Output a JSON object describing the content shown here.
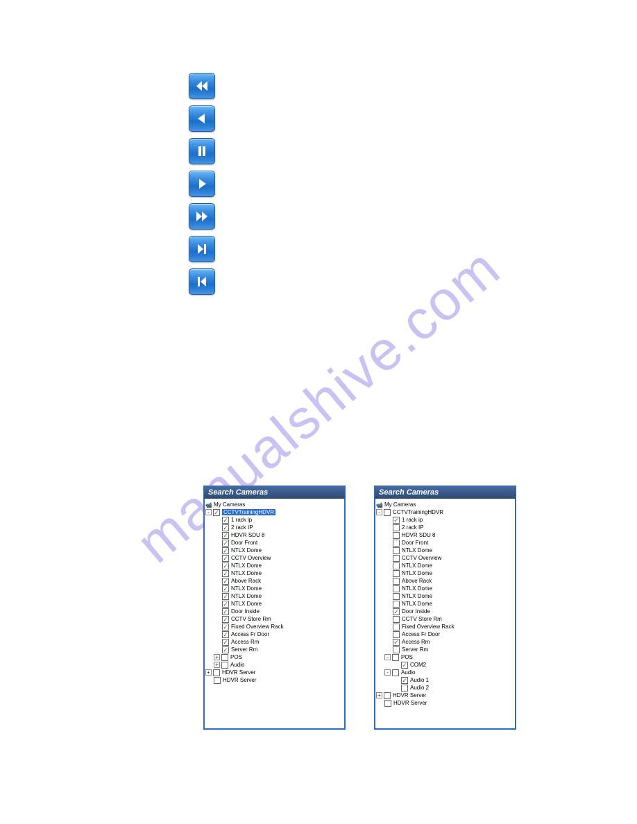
{
  "watermark": "manualshive.com",
  "buttons": [
    {
      "name": "rewind-button"
    },
    {
      "name": "step-back-button"
    },
    {
      "name": "pause-button"
    },
    {
      "name": "play-button"
    },
    {
      "name": "fast-forward-button"
    },
    {
      "name": "skip-forward-button"
    },
    {
      "name": "skip-back-button"
    }
  ],
  "panels": {
    "title": "Search Cameras",
    "left": {
      "root_label": "My Cameras",
      "server1": {
        "label": "CCTVTrainingHDVR",
        "selected": true,
        "checked": true,
        "expanded": true,
        "items": [
          {
            "label": "1 rack ip",
            "checked": true
          },
          {
            "label": "2 rack IP",
            "checked": true
          },
          {
            "label": "HDVR SDU 8",
            "checked": true
          },
          {
            "label": "Door Front",
            "checked": true
          },
          {
            "label": "NTLX Dome",
            "checked": true
          },
          {
            "label": "CCTV Overview",
            "checked": true
          },
          {
            "label": "NTLX Dome",
            "checked": true
          },
          {
            "label": "NTLX Dome",
            "checked": true
          },
          {
            "label": "Above Rack",
            "checked": true
          },
          {
            "label": "NTLX Dome",
            "checked": true
          },
          {
            "label": "NTLX Dome",
            "checked": true
          },
          {
            "label": "NTLX Dome",
            "checked": true
          },
          {
            "label": "Door Inside",
            "checked": true
          },
          {
            "label": "CCTV Store Rm",
            "checked": true
          },
          {
            "label": "Fixed Overview Rack",
            "checked": true
          },
          {
            "label": "Access Fr Door",
            "checked": true
          },
          {
            "label": "Access Rm",
            "checked": true
          },
          {
            "label": "Server Rm",
            "checked": true
          }
        ],
        "pos": {
          "label": "POS",
          "expanded": false,
          "checked": false
        },
        "audio": {
          "label": "Audio",
          "expanded": false,
          "checked": false
        }
      },
      "server2": {
        "label": "HDVR Server",
        "checked": false,
        "expanded": false
      },
      "server3": {
        "label": "HDVR Server",
        "checked": false
      }
    },
    "right": {
      "root_label": "My Cameras",
      "server1": {
        "label": "CCTVTrainingHDVR",
        "checked": false,
        "expanded": true,
        "items": [
          {
            "label": "1 rack ip",
            "checked": true
          },
          {
            "label": "2 rack IP",
            "checked": false
          },
          {
            "label": "HDVR SDU 8",
            "checked": false
          },
          {
            "label": "Door Front",
            "checked": false
          },
          {
            "label": "NTLX Dome",
            "checked": false
          },
          {
            "label": "CCTV Overview",
            "checked": false
          },
          {
            "label": "NTLX Dome",
            "checked": false
          },
          {
            "label": "NTLX Dome",
            "checked": false
          },
          {
            "label": "Above Rack",
            "checked": false
          },
          {
            "label": "NTLX Dome",
            "checked": false
          },
          {
            "label": "NTLX Dome",
            "checked": false
          },
          {
            "label": "NTLX Dome",
            "checked": false
          },
          {
            "label": "Door Inside",
            "checked": true
          },
          {
            "label": "CCTV Store Rm",
            "checked": false
          },
          {
            "label": "Fixed Overview Rack",
            "checked": false
          },
          {
            "label": "Access Fr Door",
            "checked": false
          },
          {
            "label": "Access Rm",
            "checked": true
          },
          {
            "label": "Server Rm",
            "checked": false
          }
        ],
        "pos": {
          "label": "POS",
          "expanded": true,
          "checked": false,
          "children": [
            {
              "label": "COM2",
              "checked": true
            }
          ]
        },
        "audio": {
          "label": "Audio",
          "expanded": true,
          "checked": false,
          "children": [
            {
              "label": "Audio 1",
              "checked": true
            },
            {
              "label": "Audio 2",
              "checked": false
            }
          ]
        }
      },
      "server2": {
        "label": "HDVR Server",
        "checked": false,
        "expanded": false
      },
      "server3": {
        "label": "HDVR Server",
        "checked": false
      }
    }
  }
}
